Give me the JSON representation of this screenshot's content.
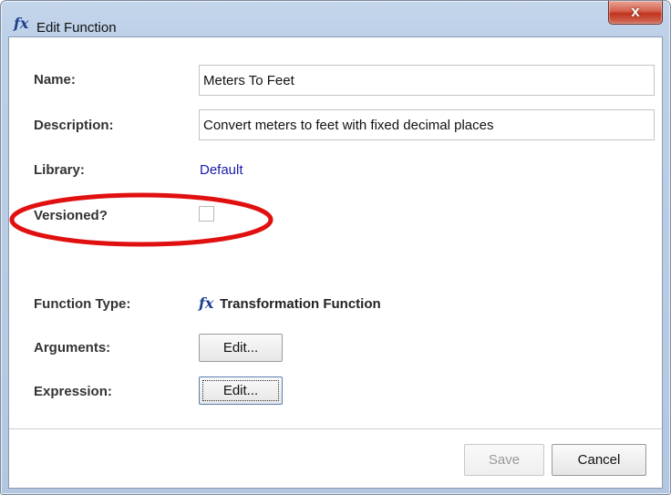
{
  "window": {
    "title": "Edit Function",
    "title_icon": "function-fx-icon",
    "close_symbol": "x"
  },
  "form": {
    "name": {
      "label": "Name:",
      "value": "Meters To Feet"
    },
    "description": {
      "label": "Description:",
      "value": "Convert meters to feet with fixed decimal places"
    },
    "library": {
      "label": "Library:",
      "value": "Default"
    },
    "versioned": {
      "label": "Versioned?",
      "checked": false
    },
    "function_type": {
      "label": "Function Type:",
      "icon": "function-fx-icon",
      "icon_glyph": "fx",
      "value": "Transformation Function"
    },
    "arguments": {
      "label": "Arguments:",
      "button_label": "Edit..."
    },
    "expression": {
      "label": "Expression:",
      "button_label": "Edit..."
    }
  },
  "footer": {
    "save_label": "Save",
    "save_enabled": false,
    "cancel_label": "Cancel"
  },
  "annotation": {
    "type": "ellipse",
    "color": "#e01010",
    "target": "versioned"
  },
  "colors": {
    "link": "#1a1ab0",
    "icon": "#1f3f8f",
    "close_button": "#c0331d"
  }
}
